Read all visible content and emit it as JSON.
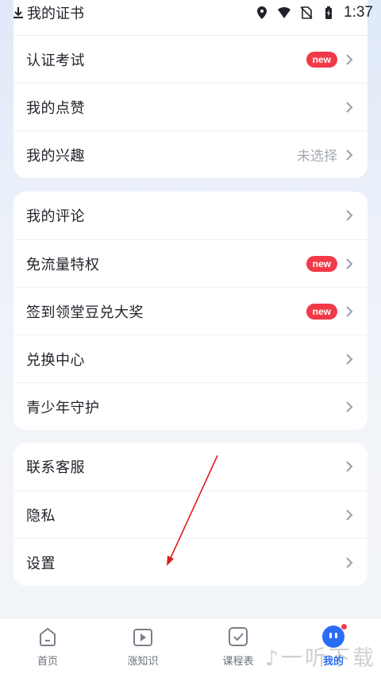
{
  "status_bar": {
    "left_text": "我的证书",
    "time": "1:37"
  },
  "card1": [
    {
      "label": "认证考试",
      "badge": "new"
    },
    {
      "label": "我的点赞"
    },
    {
      "label": "我的兴趣",
      "value": "未选择"
    }
  ],
  "card2": [
    {
      "label": "我的评论"
    },
    {
      "label": "免流量特权",
      "badge": "new"
    },
    {
      "label": "签到领堂豆兑大奖",
      "badge": "new"
    },
    {
      "label": "兑换中心"
    },
    {
      "label": "青少年守护"
    }
  ],
  "card3": [
    {
      "label": "联系客服"
    },
    {
      "label": "隐私"
    },
    {
      "label": "设置"
    }
  ],
  "nav": [
    {
      "label": "首页",
      "icon": "home-icon"
    },
    {
      "label": "涨知识",
      "icon": "play-icon"
    },
    {
      "label": "课程表",
      "icon": "schedule-icon"
    },
    {
      "label": "我的",
      "icon": "avatar-icon",
      "active": true
    }
  ],
  "watermark": "一听下载",
  "colors": {
    "badge": "#f13a48",
    "active": "#2b6cf5",
    "annotation_arrow": "#e11d1d"
  }
}
